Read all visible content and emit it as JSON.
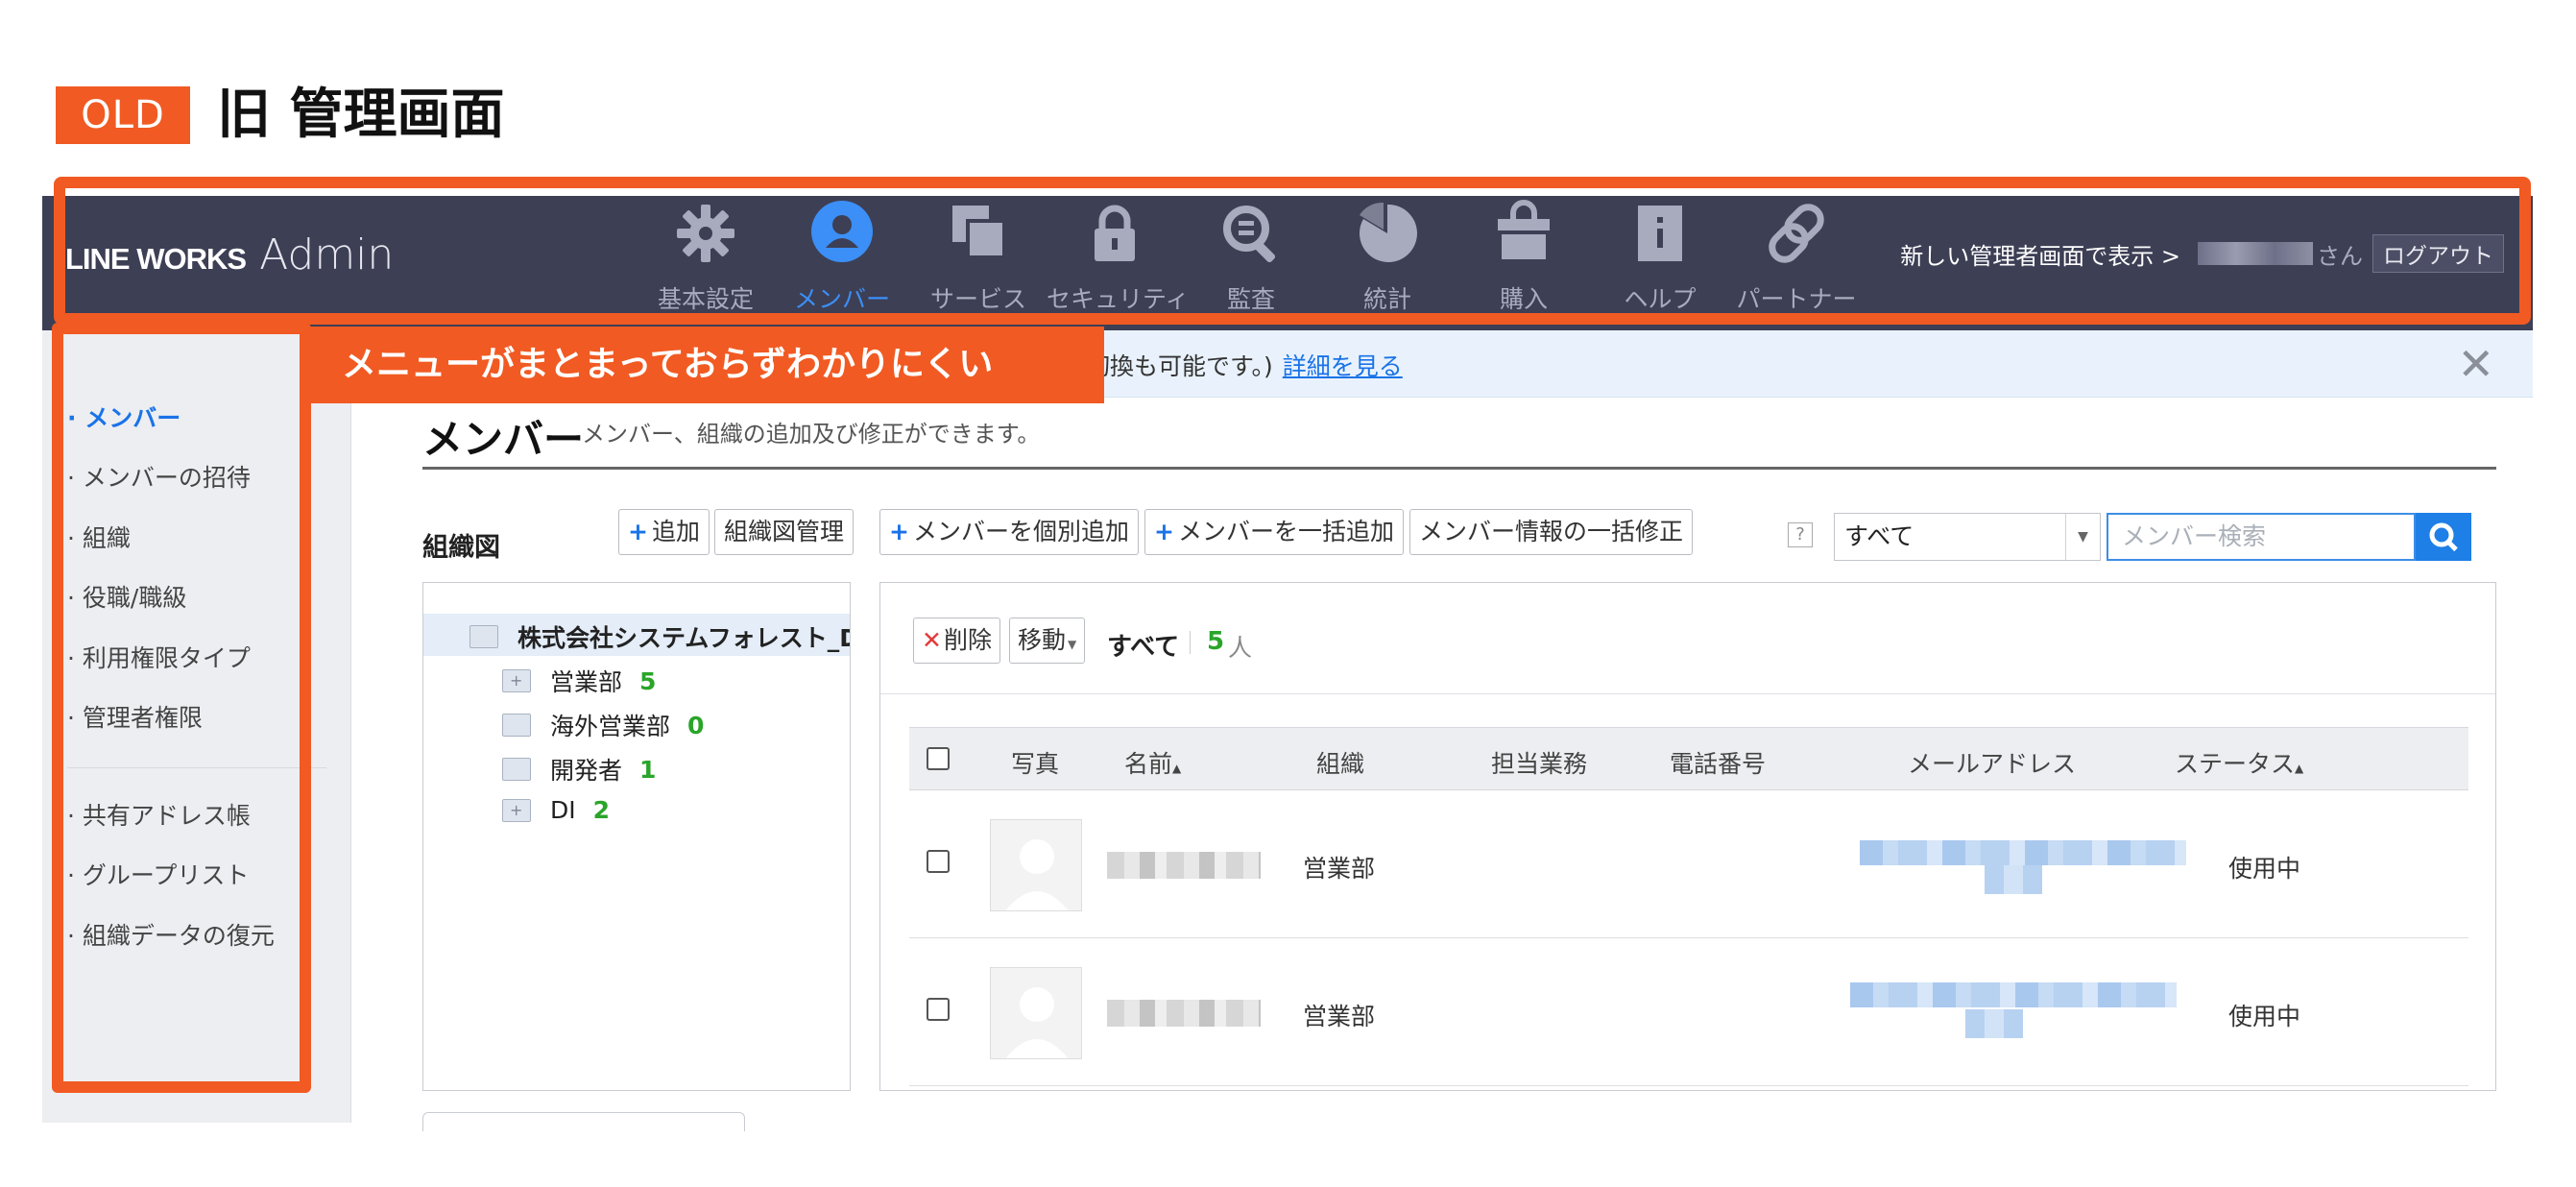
{
  "header": {
    "tag": "OLD",
    "title": "旧 管理画面"
  },
  "app": {
    "logo_main": "LINE WORKS",
    "logo_sub": "Admin",
    "nav": [
      {
        "label": "基本設定",
        "icon": "gear-icon"
      },
      {
        "label": "メンバー",
        "icon": "person-icon",
        "active": true
      },
      {
        "label": "サービス",
        "icon": "services-icon"
      },
      {
        "label": "セキュリティ",
        "icon": "lock-icon"
      },
      {
        "label": "監査",
        "icon": "audit-search-icon"
      },
      {
        "label": "統計",
        "icon": "pie-chart-icon"
      },
      {
        "label": "購入",
        "icon": "shopping-bag-icon"
      },
      {
        "label": "ヘルプ",
        "icon": "help-book-icon"
      },
      {
        "label": "パートナー",
        "icon": "link-icon"
      }
    ],
    "top_right": {
      "new_admin_link": "新しい管理者画面で表示 >",
      "san": "さん",
      "logout": "ログアウト"
    },
    "sidebar": {
      "items": [
        {
          "label": "メンバー",
          "active": true
        },
        {
          "label": "メンバーの招待"
        },
        {
          "label": "組織"
        },
        {
          "label": "役職/職級"
        },
        {
          "label": "利用権限タイプ"
        },
        {
          "label": "管理者権限"
        },
        {
          "label": "共有アドレス帳"
        },
        {
          "label": "グループリスト"
        },
        {
          "label": "組織データの復元"
        }
      ]
    },
    "banner": {
      "text": "面への切換も可能です。)",
      "link": "詳細を見る",
      "close": "✕"
    },
    "page": {
      "title": "メンバー",
      "description": "メンバー、組織の追加及び修正ができます。"
    },
    "toolbar": {
      "org_label": "組織図",
      "add": "追加",
      "org_manage": "組織図管理",
      "add_member": "メンバーを個別追加",
      "bulk_add": "メンバーを一括追加",
      "bulk_edit": "メンバー情報の一括修正",
      "help": "?",
      "filter_value": "すべて",
      "search_placeholder": "メンバー検索"
    },
    "tree": {
      "root": "株式会社システムフォレスト_D",
      "children": [
        {
          "label": "営業部",
          "count": "5"
        },
        {
          "label": "海外営業部",
          "count": "0"
        },
        {
          "label": "開発者",
          "count": "1"
        },
        {
          "label": "DI",
          "count": "2"
        }
      ]
    },
    "members": {
      "delete": "削除",
      "move": "移動",
      "all_label": "すべて",
      "count": "5",
      "count_unit": "人",
      "columns": [
        "写真",
        "名前",
        "組織",
        "担当業務",
        "電話番号",
        "メールアドレス",
        "ステータス"
      ],
      "rows": [
        {
          "org": "営業部",
          "status": "使用中"
        },
        {
          "org": "営業部",
          "status": "使用中"
        }
      ]
    }
  },
  "annotation": {
    "label": "メニューがまとまっておらずわかりにくい",
    "color": "#f15a22"
  }
}
